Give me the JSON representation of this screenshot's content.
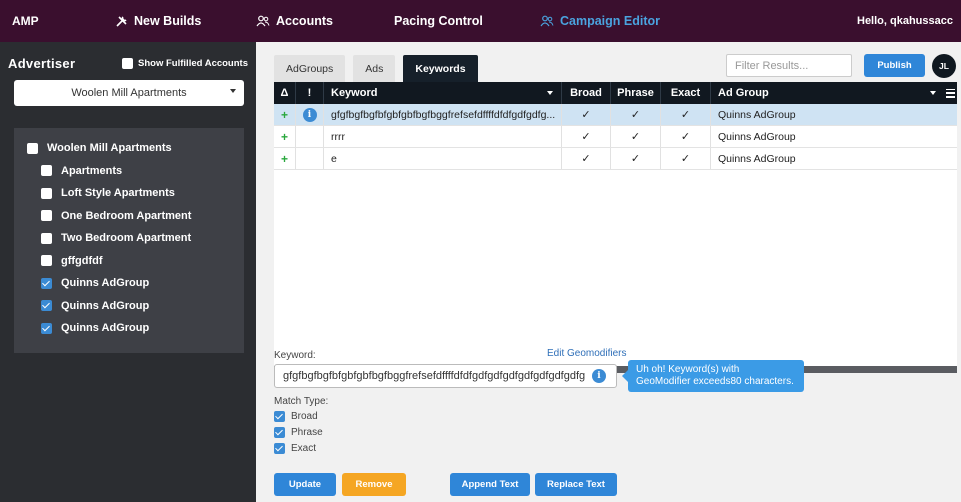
{
  "topnav": {
    "brand": "AMP",
    "items": [
      {
        "label": "New Builds",
        "icon": "tools-icon"
      },
      {
        "label": "Accounts",
        "icon": "users-icon"
      },
      {
        "label": "Pacing Control"
      },
      {
        "label": "Campaign Editor",
        "icon": "users-icon",
        "active": true
      }
    ],
    "greeting": "Hello, qkahussacc"
  },
  "sidebar": {
    "title": "Advertiser",
    "show_fulfilled_label": "Show Fulfilled Accounts",
    "show_fulfilled_checked": false,
    "advertiser_selected": "Woolen Mill Apartments",
    "tree": [
      {
        "label": "Woolen Mill Apartments",
        "checked": false,
        "level": "root"
      },
      {
        "label": "Apartments",
        "checked": false,
        "level": "child"
      },
      {
        "label": "Loft Style Apartments",
        "checked": false,
        "level": "child"
      },
      {
        "label": "One Bedroom Apartment",
        "checked": false,
        "level": "child"
      },
      {
        "label": "Two Bedroom Apartment",
        "checked": false,
        "level": "child"
      },
      {
        "label": "gffgdfdf",
        "checked": false,
        "level": "child"
      },
      {
        "label": "Quinns AdGroup",
        "checked": true,
        "level": "child"
      },
      {
        "label": "Quinns AdGroup",
        "checked": true,
        "level": "child"
      },
      {
        "label": "Quinns AdGroup",
        "checked": true,
        "level": "child"
      }
    ]
  },
  "main": {
    "tabs": [
      {
        "label": "AdGroups",
        "active": false
      },
      {
        "label": "Ads",
        "active": false
      },
      {
        "label": "Keywords",
        "active": true
      }
    ],
    "filter_placeholder": "Filter Results...",
    "publish_label": "Publish",
    "avatar_initials": "JL",
    "grid": {
      "columns": {
        "delta": "Δ",
        "bang": "!",
        "keyword": "Keyword",
        "broad": "Broad",
        "phrase": "Phrase",
        "exact": "Exact",
        "adgroup": "Ad Group"
      },
      "rows": [
        {
          "delta": "+",
          "info": "i",
          "keyword": "gfgfbgfbgfbfgbfgbfbgfbggfrefsefdffffdfdfgdfgdfg...",
          "broad": "✓",
          "phrase": "✓",
          "exact": "✓",
          "adgroup": "Quinns AdGroup",
          "selected": true
        },
        {
          "delta": "+",
          "info": "",
          "keyword": "rrrr",
          "broad": "✓",
          "phrase": "✓",
          "exact": "✓",
          "adgroup": "Quinns AdGroup",
          "selected": false
        },
        {
          "delta": "+",
          "info": "",
          "keyword": "e",
          "broad": "✓",
          "phrase": "✓",
          "exact": "✓",
          "adgroup": "Quinns AdGroup",
          "selected": false
        }
      ]
    },
    "editor": {
      "keyword_label": "Keyword:",
      "edit_geomodifiers": "Edit Geomodifiers",
      "keyword_value": "gfgfbgfbgfbfgbfgbfbgfbggfrefsefdffffdfdfgdfgdfgdfgdfgdfgdfgdfg",
      "info": "i",
      "tooltip": "Uh oh! Keyword(s) with GeoModifier exceeds80 characters.",
      "match_type_label": "Match Type:",
      "match_types": [
        {
          "label": "Broad",
          "checked": true
        },
        {
          "label": "Phrase",
          "checked": true
        },
        {
          "label": "Exact",
          "checked": true
        }
      ],
      "buttons": {
        "update": "Update",
        "remove": "Remove",
        "append": "Append Text",
        "replace": "Replace Text"
      }
    }
  },
  "colors": {
    "nav_bg": "#3a0f2e",
    "active_nav": "#4aa3df",
    "sidebar_bg": "#2b2d31",
    "primary_button": "#2f86d8",
    "remove_button": "#f5a623",
    "selected_row": "#cfe3f3",
    "tooltip": "#3b9be6"
  }
}
